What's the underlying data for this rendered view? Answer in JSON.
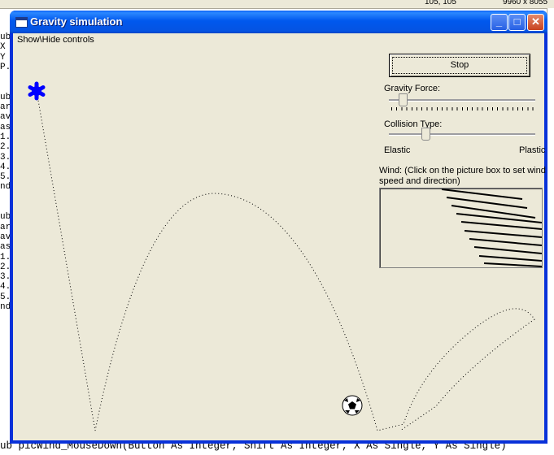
{
  "ide": {
    "coords": "105, 105",
    "size": "9960 x 8055",
    "code_left_chars": [
      "ub",
      "X",
      "Y",
      "P.",
      "",
      "",
      "ub",
      "ar",
      "av",
      "as",
      "1.",
      "2.",
      "3.",
      "4.",
      "5.",
      "nd",
      "",
      "",
      "ub",
      "ar",
      "av",
      "as",
      "1.",
      "2.",
      "3.",
      "4.",
      "5.",
      "nd"
    ],
    "bottom_code": "ub picWind_MouseDown(Button As Integer, Shift As Integer, X As Single, Y As Single)"
  },
  "window": {
    "title": "Gravity simulation",
    "minimize_label": "_",
    "maximize_label": "□",
    "close_label": "✕"
  },
  "menu": {
    "show_hide": "Show\\Hide controls"
  },
  "controls": {
    "stop_label": "Stop",
    "gravity_label": "Gravity Force:",
    "gravity_value": 0.08,
    "collision_label": "Collision Type:",
    "collision_value": 0.3,
    "elastic_label": "Elastic",
    "plastic_label": "Plastic",
    "wind_label": "Wind: (Click on the picture box to set wind speed and direction)"
  },
  "icons": {
    "sun": "asterisk-icon",
    "ball": "soccer-ball-icon"
  },
  "colors": {
    "title_blue": "#0058ee",
    "asterisk_blue": "#0000ff",
    "client_bg": "#ece9d8"
  }
}
